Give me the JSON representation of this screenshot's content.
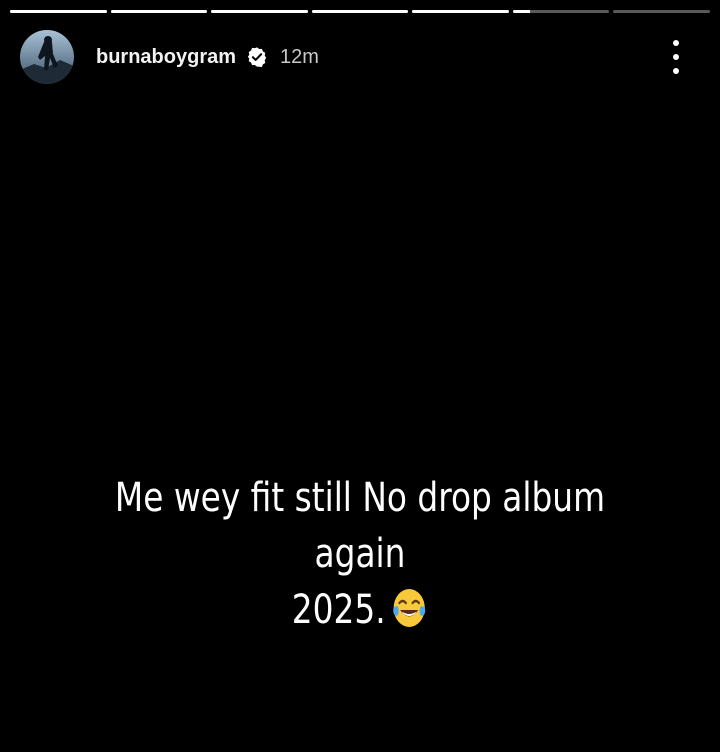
{
  "story": {
    "progress": {
      "segments": [
        1,
        1,
        1,
        1,
        1,
        0.18,
        0
      ],
      "active_color": "#ffffff",
      "inactive_color": "rgba(255,255,255,0.35)"
    },
    "header": {
      "username": "burnaboygram",
      "time_ago": "12m",
      "verified": true,
      "avatar_icon": "avatar-photo",
      "verified_icon": "verified-badge-icon",
      "more_icon": "more-vertical-icon"
    },
    "caption": {
      "line1": "Me wey fit still No drop album again",
      "line2": "2025.",
      "emoji": "face-with-tears-of-joy"
    },
    "colors": {
      "background": "#000000",
      "text": "#ffffff",
      "muted": "#c8c8c8"
    }
  }
}
